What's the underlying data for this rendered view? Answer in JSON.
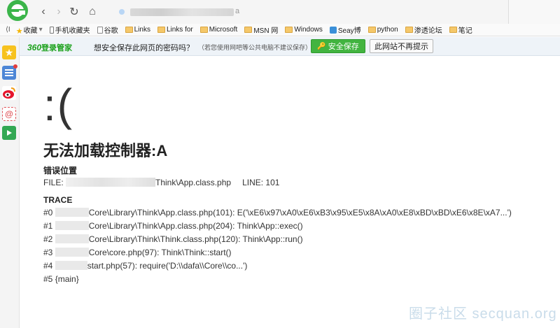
{
  "browser": {
    "address_tail": "a",
    "nav": {
      "back": "‹",
      "forward": "›",
      "reload": "↻",
      "home": "⌂"
    }
  },
  "bookmarks": [
    {
      "label": "收藏",
      "icon": "star-icon"
    },
    {
      "label": "手机收藏夹",
      "icon": "phone-icon"
    },
    {
      "label": "谷歌",
      "icon": "page-icon"
    },
    {
      "label": "Links",
      "icon": "folder-icon"
    },
    {
      "label": "Links for",
      "icon": "folder-icon"
    },
    {
      "label": "Microsoft",
      "icon": "folder-icon"
    },
    {
      "label": "MSN 网",
      "icon": "folder-icon"
    },
    {
      "label": "Windows",
      "icon": "folder-icon"
    },
    {
      "label": "Seay博",
      "icon": "seay-icon"
    },
    {
      "label": "python",
      "icon": "folder-icon"
    },
    {
      "label": "渗透论坛",
      "icon": "folder-icon"
    },
    {
      "label": "笔记",
      "icon": "folder-icon"
    }
  ],
  "password_bar": {
    "brand_number": "360",
    "brand_text": "登录管家",
    "question": "想安全保存此网页的密码吗？",
    "note": "（若您使用网吧等公共电脑不建议保存）",
    "save_label": "安全保存",
    "never_label": "此网站不再提示"
  },
  "error": {
    "face": ":(",
    "title": "无法加载控制器:A",
    "location_label": "错误位置",
    "file_prefix": "FILE: ",
    "file_suffix": "Think\\App.class.php",
    "line_text": "LINE: 101",
    "trace_label": "TRACE",
    "trace": [
      {
        "num": "#0 ",
        "text": "Core\\Library\\Think\\App.class.php(101): E('\\xE6\\x97\\xA0\\xE6\\xB3\\x95\\xE5\\x8A\\xA0\\xE8\\xBD\\xBD\\xE6\\x8E\\xA7...')"
      },
      {
        "num": "#1 ",
        "text": "Core\\Library\\Think\\App.class.php(204): Think\\App::exec()"
      },
      {
        "num": "#2 ",
        "text": "Core\\Library\\Think\\Think.class.php(120): Think\\App::run()"
      },
      {
        "num": "#3 ",
        "text": "Core\\core.php(97): Think\\Think::start()"
      },
      {
        "num": "#4 ",
        "text": "start.php(57): require('D:\\\\dafa\\\\Core\\\\co...')"
      },
      {
        "num": "#5 ",
        "text": "{main}"
      }
    ]
  },
  "watermark": "圈子社区 secquan.org"
}
